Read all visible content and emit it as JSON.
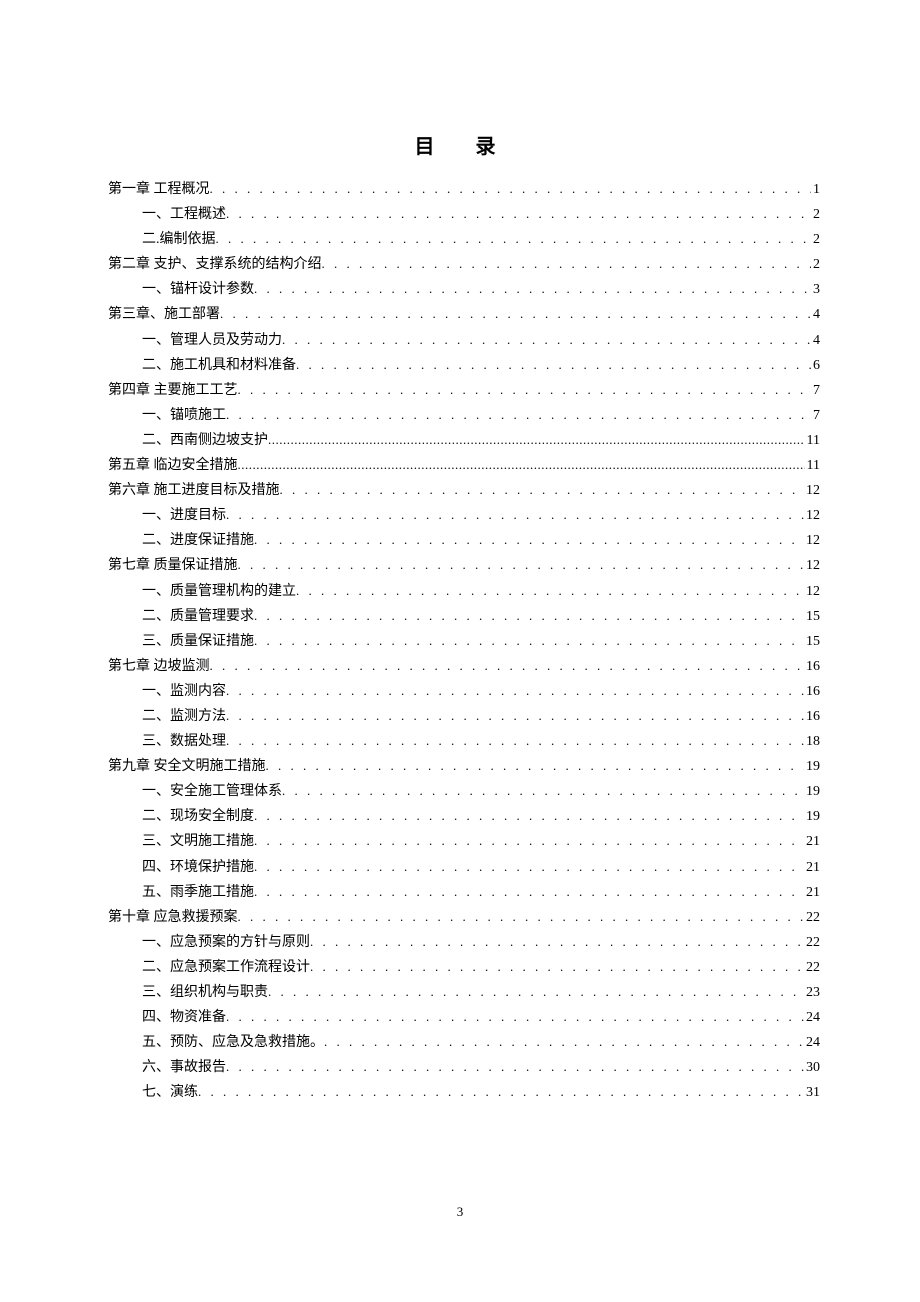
{
  "title": "目 录",
  "page_number": "3",
  "toc": [
    {
      "level": 0,
      "label": "第一章 工程概况",
      "page": "1",
      "style": "normal"
    },
    {
      "level": 1,
      "label": "一、工程概述",
      "page": "2",
      "style": "normal"
    },
    {
      "level": 1,
      "label": "二.编制依据",
      "page": "2",
      "style": "normal"
    },
    {
      "level": 0,
      "label": "第二章   支护、支撑系统的结构介绍",
      "page": "2",
      "style": "normal"
    },
    {
      "level": 1,
      "label": "一、锚杆设计参数",
      "page": "3",
      "style": "normal"
    },
    {
      "level": 0,
      "label": "第三章、施工部署",
      "page": "4",
      "style": "normal"
    },
    {
      "level": 1,
      "label": "一、管理人员及劳动力",
      "page": "4",
      "style": "normal"
    },
    {
      "level": 1,
      "label": "二、施工机具和材料准备",
      "page": "6",
      "style": "normal"
    },
    {
      "level": 0,
      "label": "第四章   主要施工工艺",
      "page": "7",
      "style": "normal"
    },
    {
      "level": 1,
      "label": "一、锚喷施工",
      "page": "7",
      "style": "normal"
    },
    {
      "level": 1,
      "label": "二、西南侧边坡支护",
      "page": "11",
      "style": "tight"
    },
    {
      "level": 0,
      "label": "第五章    临边安全措施",
      "page": "11",
      "style": "tight"
    },
    {
      "level": 0,
      "label": "第六章     施工进度目标及措施",
      "page": "12",
      "style": "normal"
    },
    {
      "level": 1,
      "label": "一、进度目标",
      "page": "12",
      "style": "normal"
    },
    {
      "level": 1,
      "label": "二、进度保证措施",
      "page": "12",
      "style": "normal"
    },
    {
      "level": 0,
      "label": "第七章   质量保证措施",
      "page": "12",
      "style": "normal"
    },
    {
      "level": 1,
      "label": "一、质量管理机构的建立",
      "page": "12",
      "style": "normal"
    },
    {
      "level": 1,
      "label": "二、质量管理要求",
      "page": "15",
      "style": "normal"
    },
    {
      "level": 1,
      "label": "三、质量保证措施",
      "page": "15",
      "style": "normal"
    },
    {
      "level": 0,
      "label": "第七章   边坡监测",
      "page": "16",
      "style": "normal"
    },
    {
      "level": 1,
      "label": "一、监测内容",
      "page": "16",
      "style": "normal"
    },
    {
      "level": 1,
      "label": "二、监测方法",
      "page": "16",
      "style": "normal"
    },
    {
      "level": 1,
      "label": "三、数据处理",
      "page": "18",
      "style": "normal"
    },
    {
      "level": 0,
      "label": "第九章   安全文明施工措施",
      "page": "19",
      "style": "normal"
    },
    {
      "level": 1,
      "label": "一、安全施工管理体系",
      "page": "19",
      "style": "normal"
    },
    {
      "level": 1,
      "label": "二、现场安全制度",
      "page": "19",
      "style": "normal"
    },
    {
      "level": 1,
      "label": "三、文明施工措施",
      "page": "21",
      "style": "normal"
    },
    {
      "level": 1,
      "label": "四、环境保护措施",
      "page": "21",
      "style": "normal"
    },
    {
      "level": 1,
      "label": "五、雨季施工措施",
      "page": "21",
      "style": "normal"
    },
    {
      "level": 0,
      "label": "第十章   应急救援预案",
      "page": "22",
      "style": "normal"
    },
    {
      "level": 1,
      "label": "一、应急预案的方针与原则",
      "page": "22",
      "style": "normal"
    },
    {
      "level": 1,
      "label": "二、应急预案工作流程设计",
      "page": "22",
      "style": "normal"
    },
    {
      "level": 1,
      "label": "三、组织机构与职责",
      "page": "23",
      "style": "normal"
    },
    {
      "level": 1,
      "label": "四、物资准备",
      "page": "24",
      "style": "normal"
    },
    {
      "level": 1,
      "label": "五、预防、应急及急救措施。",
      "page": "24",
      "style": "normal"
    },
    {
      "level": 1,
      "label": "六、事故报告",
      "page": "30",
      "style": "normal"
    },
    {
      "level": 1,
      "label": "七、演练",
      "page": "31",
      "style": "normal"
    }
  ]
}
